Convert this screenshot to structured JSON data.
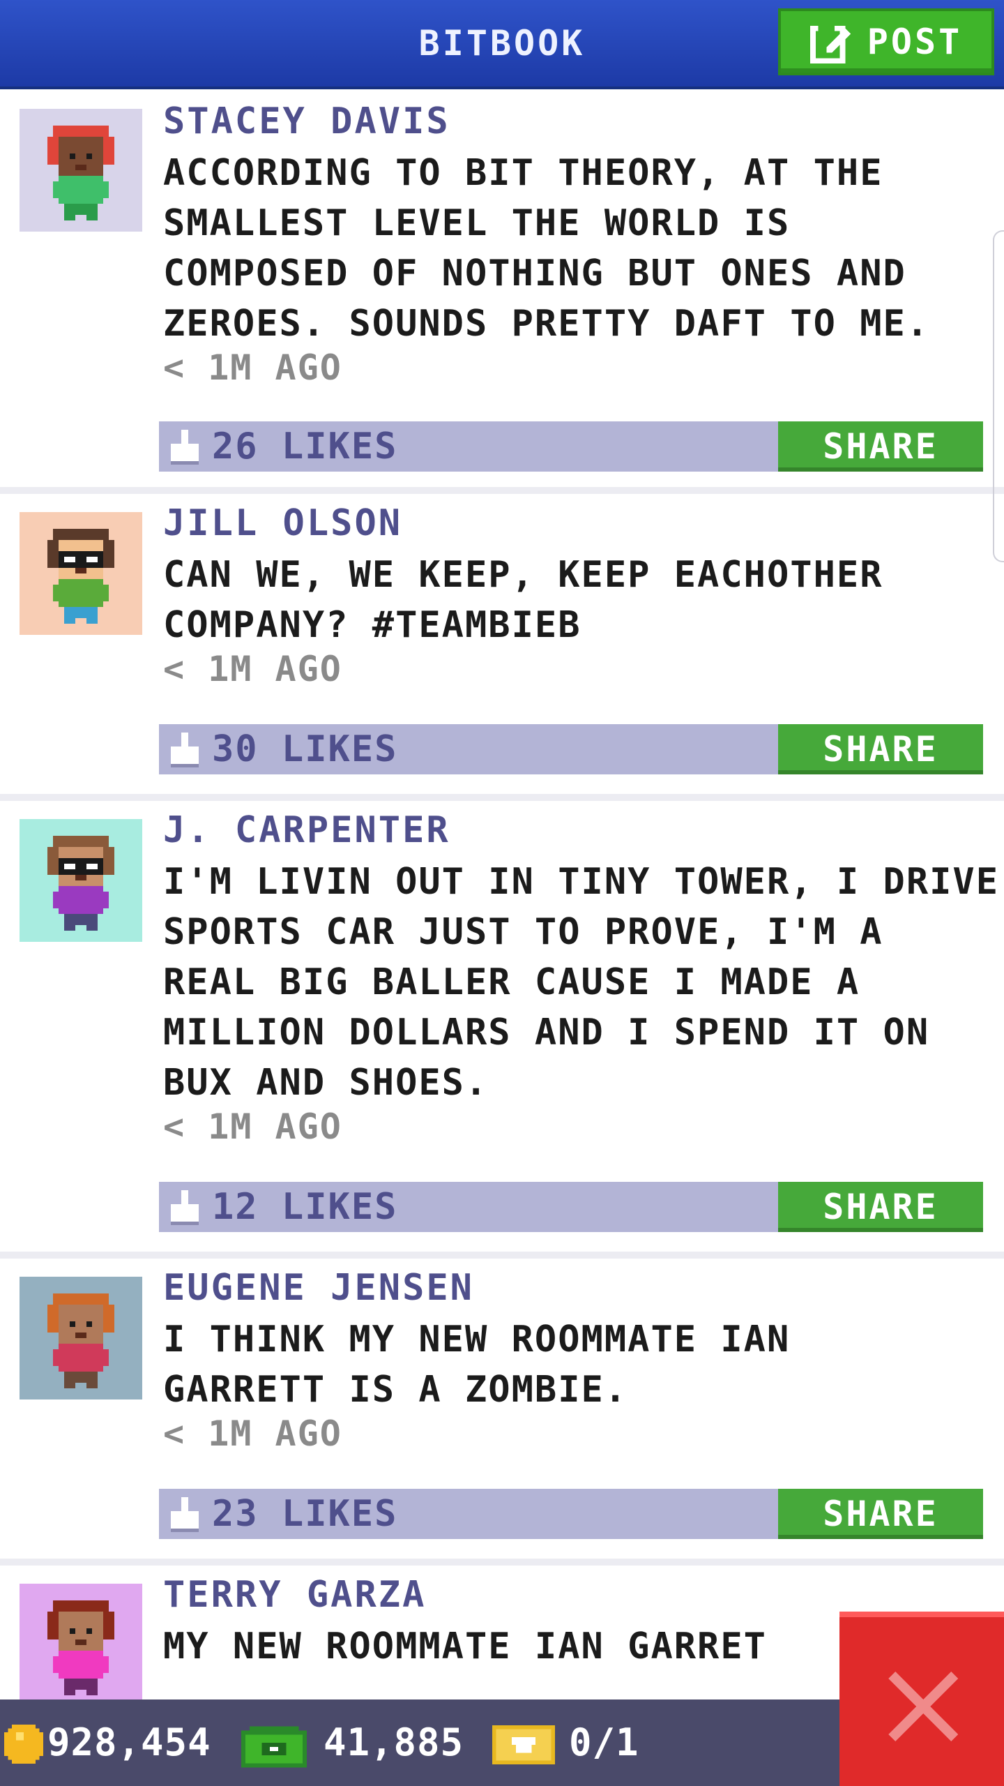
{
  "header": {
    "title": "BITBOOK",
    "post_label": "POST"
  },
  "posts": [
    {
      "author": "STACEY DAVIS",
      "lines": [
        "ACCORDING TO BIT THEORY, AT THE",
        "SMALLEST LEVEL THE WORLD IS",
        "COMPOSED OF NOTHING BUT ONES AND",
        "ZEROES. SOUNDS PRETTY DAFT TO ME."
      ],
      "time": "< 1M AGO",
      "likes": "26 LIKES",
      "share_label": "SHARE",
      "avatar": {
        "bg": "#d8d4ea",
        "hair": "#e0453a",
        "skin": "#7a4a32",
        "shirt": "#3fbf6a",
        "pants": "#2a9c4a",
        "glasses": false
      }
    },
    {
      "author": "JILL OLSON",
      "lines": [
        "CAN WE, WE KEEP, KEEP EACHOTHER",
        "COMPANY? #TEAMBIEB"
      ],
      "time": "< 1M AGO",
      "likes": "30 LIKES",
      "share_label": "SHARE",
      "avatar": {
        "bg": "#f8cdb4",
        "hair": "#5a3a2a",
        "skin": "#f2c08e",
        "shirt": "#5aab3a",
        "pants": "#3aa0d0",
        "glasses": true
      }
    },
    {
      "author": "J. CARPENTER",
      "lines": [
        "I'M LIVIN OUT IN TINY TOWER, I DRIVE A",
        "SPORTS CAR JUST TO PROVE, I'M A",
        "REAL BIG BALLER CAUSE I MADE A",
        "MILLION DOLLARS AND I SPEND IT ON",
        "BUX AND SHOES."
      ],
      "time": "< 1M AGO",
      "likes": "12 LIKES",
      "share_label": "SHARE",
      "avatar": {
        "bg": "#a8ece0",
        "hair": "#8a5a3a",
        "skin": "#c8906a",
        "shirt": "#9a3ac0",
        "pants": "#4a4a7a",
        "glasses": true
      }
    },
    {
      "author": "EUGENE JENSEN",
      "lines": [
        "I THINK MY NEW ROOMMATE IAN",
        "GARRETT IS A ZOMBIE."
      ],
      "time": "< 1M AGO",
      "likes": "23 LIKES",
      "share_label": "SHARE",
      "avatar": {
        "bg": "#94b0c0",
        "hair": "#d06a2a",
        "skin": "#b07a5a",
        "shirt": "#d03a5a",
        "pants": "#6a4a3a",
        "glasses": false
      }
    },
    {
      "author": "TERRY GARZA",
      "lines": [
        "MY NEW ROOMMATE IAN GARRET"
      ],
      "time": "",
      "likes": "",
      "share_label": "",
      "avatar": {
        "bg": "#e0a8f0",
        "hair": "#8a2a1a",
        "skin": "#b07a5a",
        "shirt": "#f03ac0",
        "pants": "#6a2a6a",
        "glasses": false
      }
    }
  ],
  "footer": {
    "coins": "928,454",
    "bux": "41,885",
    "tickets": "0/1"
  },
  "colors": {
    "accent_blue": "#2f53c9",
    "share_green": "#46a93a",
    "likes_bar": "#b3b4d6",
    "author_text": "#4f4f8c",
    "close_red": "#e02a2a"
  },
  "icons": [
    "edit-icon",
    "like-icon",
    "coin-icon",
    "bux-icon",
    "ticket-icon",
    "close-icon"
  ]
}
